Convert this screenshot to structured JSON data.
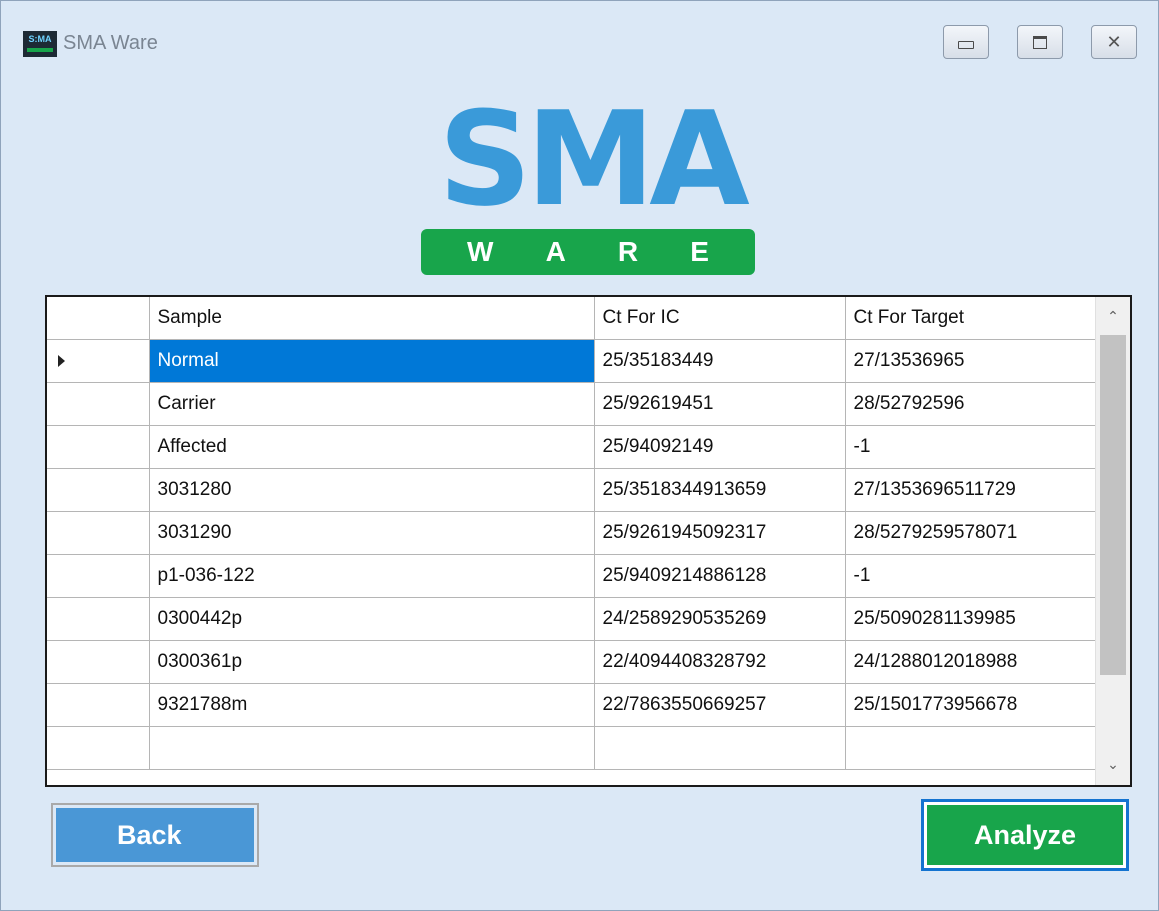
{
  "window": {
    "title": "SMA Ware",
    "icon": "sma-app-icon",
    "controls": [
      "minimize-icon",
      "maximize-icon",
      "close-icon"
    ],
    "close_glyph": "✕"
  },
  "logo": {
    "word": "SMA",
    "tagline_letters": [
      "W",
      "A",
      "R",
      "E"
    ],
    "colors": {
      "word": "#3a9ad9",
      "bar": "#18a54b"
    }
  },
  "grid": {
    "columns": [
      "Sample",
      "Ct For IC",
      "Ct For Target"
    ],
    "selected_row": 0,
    "rows": [
      [
        "Normal",
        "25/35183449",
        "27/13536965"
      ],
      [
        "Carrier",
        "25/92619451",
        "28/52792596"
      ],
      [
        "Affected",
        "25/94092149",
        "-1"
      ],
      [
        "3031280",
        "25/3518344913659",
        "27/1353696511729"
      ],
      [
        "3031290",
        "25/9261945092317",
        "28/5279259578071"
      ],
      [
        "p1-036-122",
        "25/9409214886128",
        "-1"
      ],
      [
        "0300442p",
        "24/2589290535269",
        "25/5090281139985"
      ],
      [
        "0300361p",
        "22/4094408328792",
        "24/1288012018988"
      ],
      [
        "9321788m",
        "22/7863550669257",
        "25/1501773956678"
      ]
    ],
    "scroll_up": "⌃",
    "scroll_down": "⌄",
    "selection_color": "#0078d7"
  },
  "buttons": {
    "back": "Back",
    "analyze": "Analyze",
    "colors": {
      "back": "#4a97d6",
      "analyze": "#18a54b"
    }
  }
}
